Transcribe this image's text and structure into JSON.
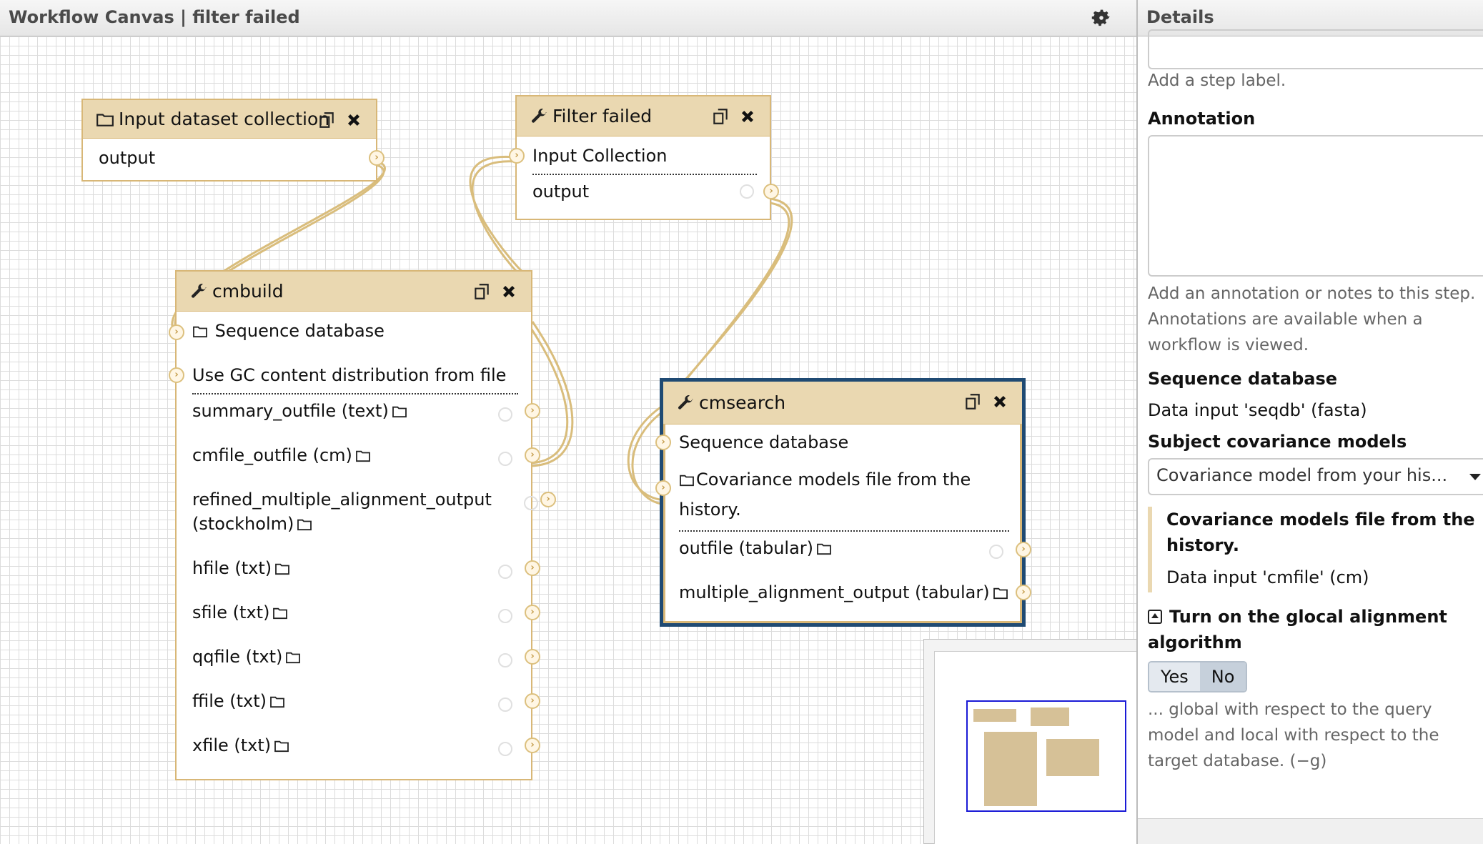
{
  "canvas": {
    "title": "Workflow Canvas | filter failed"
  },
  "nodes": {
    "input_collection": {
      "title": "Input dataset collection",
      "output": "output"
    },
    "filter_failed": {
      "title": "Filter failed",
      "input": "Input Collection",
      "output": "output"
    },
    "cmbuild": {
      "title": "cmbuild",
      "inputs": [
        "Sequence database",
        "Use GC content distribution from file"
      ],
      "outputs": [
        "summary_outfile (text)",
        "cmfile_outfile (cm)",
        "refined_multiple_alignment_output (stockholm)",
        "hfile (txt)",
        "sfile (txt)",
        "qqfile (txt)",
        "ffile (txt)",
        "xfile (txt)"
      ]
    },
    "cmsearch": {
      "title": "cmsearch",
      "inputs": [
        "Sequence database",
        "Covariance models file from the history."
      ],
      "outputs": [
        "outfile (tabular)",
        "multiple_alignment_output (tabular)"
      ]
    }
  },
  "details": {
    "title": "Details",
    "step_label_help": "Add a step label.",
    "annotation_label": "Annotation",
    "annotation_help": "Add an annotation or notes to this step. Annotations are available when a workflow is viewed.",
    "seq_db_label": "Sequence database",
    "seq_db_value": "Data input 'seqdb' (fasta)",
    "subject_label": "Subject covariance models",
    "subject_select": "Covariance model from your his...",
    "cm_file_label": "Covariance models file from the history.",
    "cm_file_value": "Data input 'cmfile' (cm)",
    "glocal_label": "Turn on the glocal alignment algorithm",
    "toggle_yes": "Yes",
    "toggle_no": "No",
    "glocal_help": "... global with respect to the query model and local with respect to the target database. (−g)"
  },
  "colors": {
    "node_header": "#ead8b1",
    "node_border": "#d8b777",
    "selected_border": "#1f4a73",
    "connector": "#d9bd7c"
  }
}
